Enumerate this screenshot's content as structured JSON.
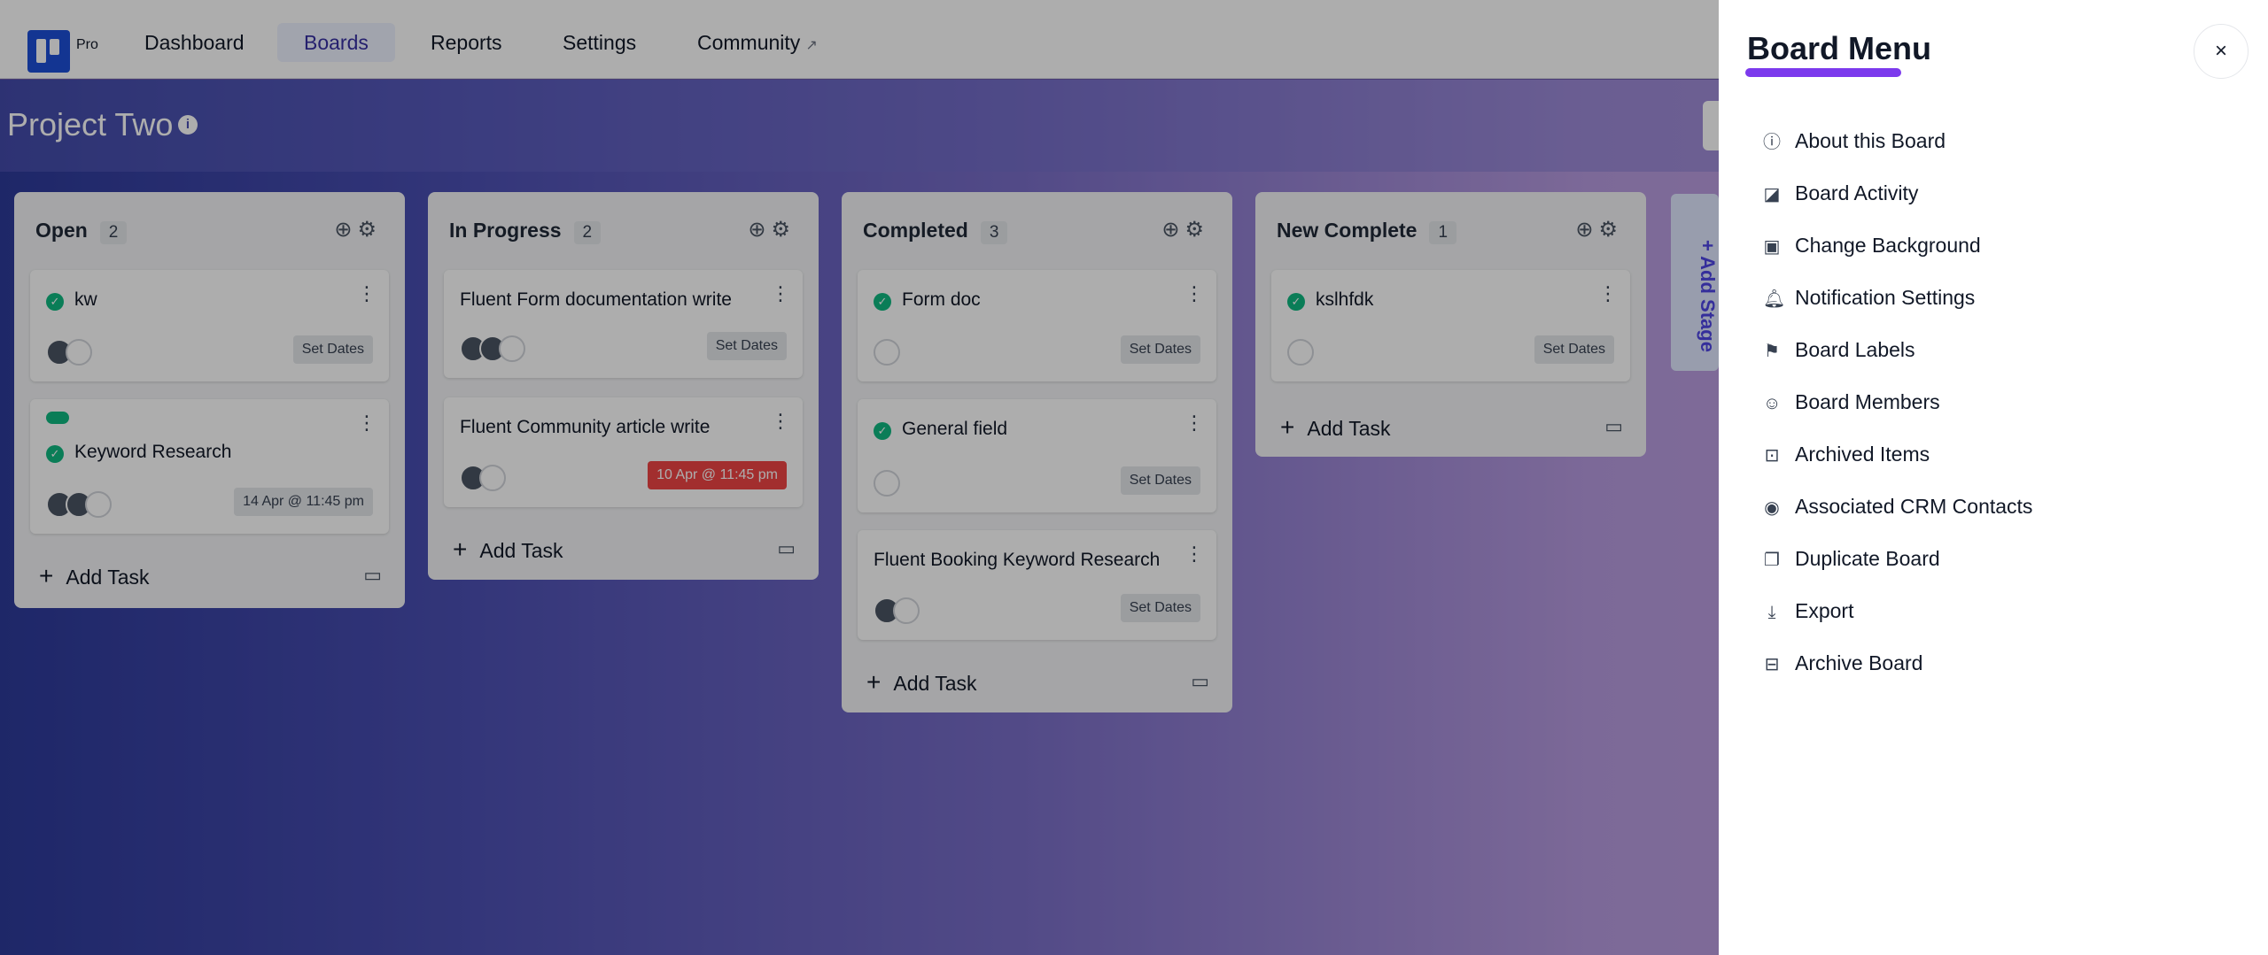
{
  "nav": {
    "logo_suffix": "Pro",
    "items": [
      {
        "label": "Dashboard"
      },
      {
        "label": "Boards",
        "active": true
      },
      {
        "label": "Reports"
      },
      {
        "label": "Settings"
      },
      {
        "label": "Community",
        "external": true
      }
    ]
  },
  "board": {
    "title": "Project Two",
    "add_stage_label": "+ Add Stage",
    "add_task_label": "Add Task",
    "stages": [
      {
        "name": "Open",
        "count": "2",
        "cards": [
          {
            "title": "kw",
            "date": "Set Dates",
            "done": true
          },
          {
            "title": "Keyword Research",
            "date": "14 Apr @ 11:45 pm",
            "done": true,
            "label_color": "#10b981"
          }
        ]
      },
      {
        "name": "In Progress",
        "count": "2",
        "cards": [
          {
            "title": "Fluent Form documentation write",
            "date": "Set Dates",
            "done": false
          },
          {
            "title": "Fluent Community article write",
            "date": "10 Apr @ 11:45 pm",
            "done": false,
            "overdue": true
          }
        ]
      },
      {
        "name": "Completed",
        "count": "3",
        "cards": [
          {
            "title": "Form doc",
            "date": "Set Dates",
            "done": true
          },
          {
            "title": "General field",
            "date": "Set Dates",
            "done": true
          },
          {
            "title": "Fluent Booking Keyword Research",
            "date": "Set Dates",
            "done": false
          }
        ]
      },
      {
        "name": "New Complete",
        "count": "1",
        "cards": [
          {
            "title": "kslhfdk",
            "date": "Set Dates",
            "done": true
          }
        ]
      }
    ]
  },
  "drawer": {
    "title": "Board Menu",
    "close_label": "×",
    "items": [
      {
        "label": "About this Board",
        "icon": "info-icon",
        "glyph": "ⓘ"
      },
      {
        "label": "Board Activity",
        "icon": "activity-icon",
        "glyph": "◪"
      },
      {
        "label": "Change Background",
        "icon": "background-icon",
        "glyph": "▣"
      },
      {
        "label": "Notification Settings",
        "icon": "bell-icon",
        "glyph": "🔔︎"
      },
      {
        "label": "Board Labels",
        "icon": "flag-icon",
        "glyph": "⚑"
      },
      {
        "label": "Board Members",
        "icon": "members-icon",
        "glyph": "☺"
      },
      {
        "label": "Archived Items",
        "icon": "archived-icon",
        "glyph": "⊡"
      },
      {
        "label": "Associated CRM Contacts",
        "icon": "contact-icon",
        "glyph": "◉"
      },
      {
        "label": "Duplicate Board",
        "icon": "duplicate-icon",
        "glyph": "❐"
      },
      {
        "label": "Export",
        "icon": "export-icon",
        "glyph": "⤓"
      },
      {
        "label": "Archive Board",
        "icon": "archive-icon",
        "glyph": "⊟"
      }
    ]
  }
}
